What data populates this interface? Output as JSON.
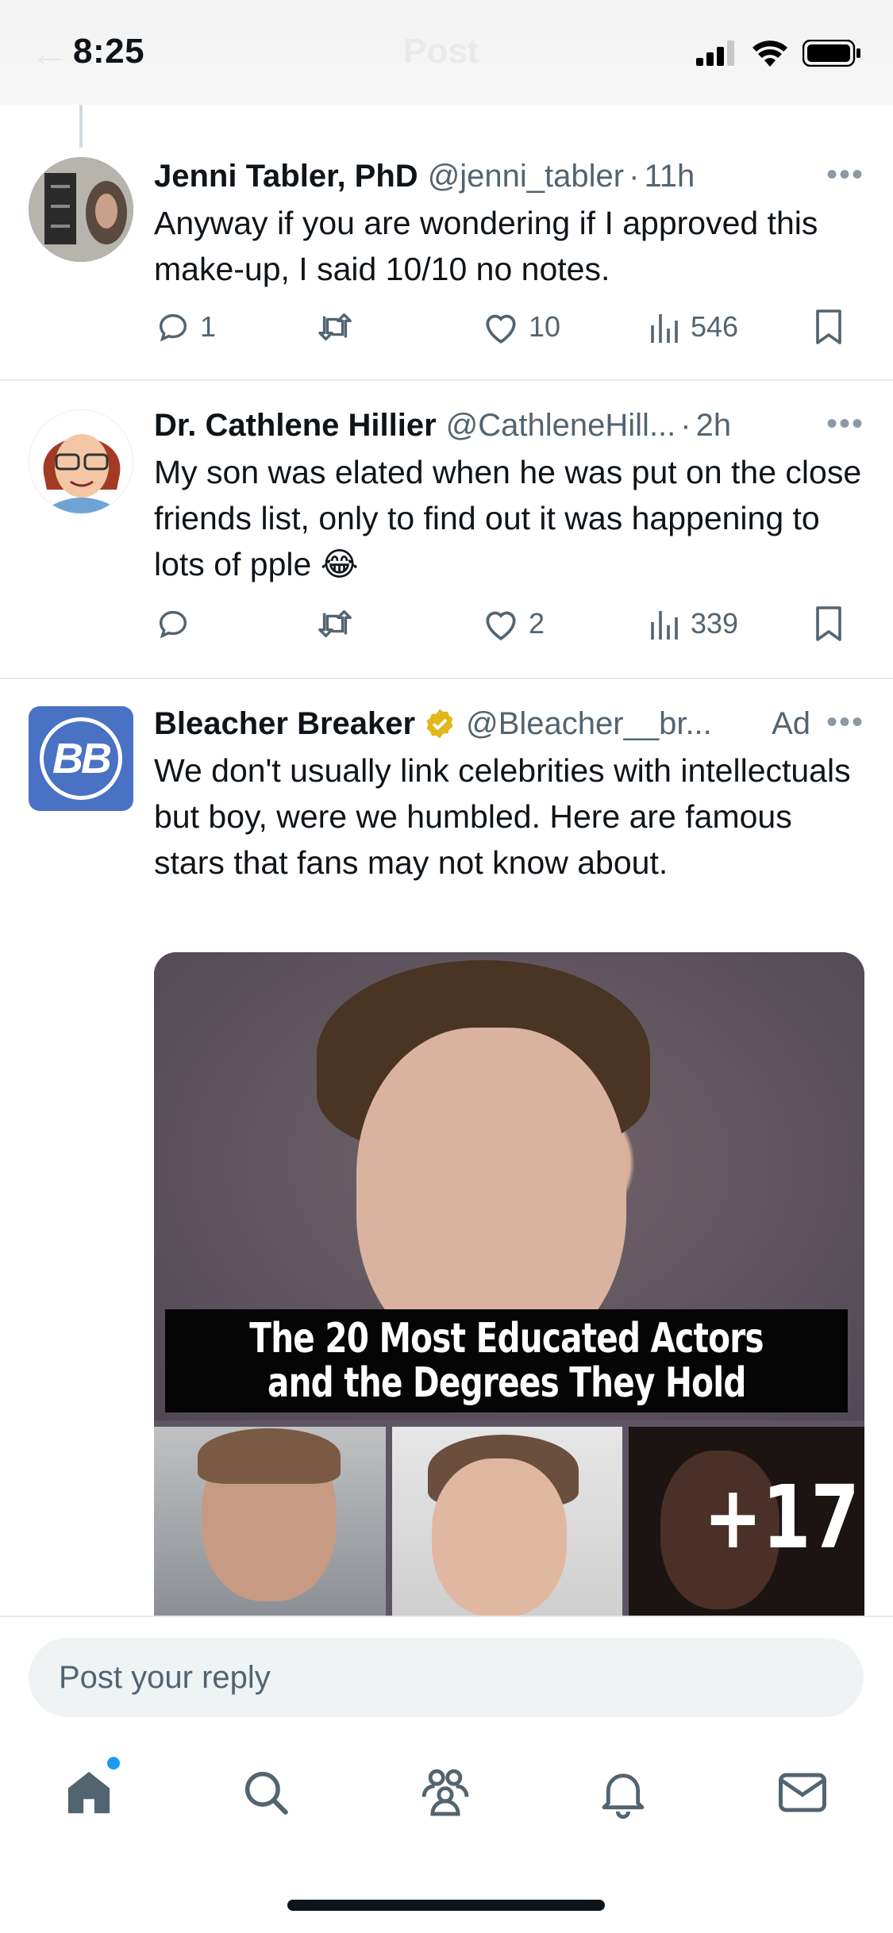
{
  "status_bar": {
    "time": "8:25",
    "title": "Post",
    "icons": [
      "back-arrow-icon",
      "signal-icon",
      "wifi-icon",
      "battery-icon"
    ]
  },
  "tweets": [
    {
      "name": "Jenni Tabler, PhD",
      "handle": "@jenni_tabler",
      "time": "11h",
      "text": "Anyway if you are wondering if I approved this make-up, I said 10/10 no notes.",
      "replies": "1",
      "retweets": "",
      "likes": "10",
      "views": "546"
    },
    {
      "name": "Dr. Cathlene Hillier",
      "handle": "@CathleneHill...",
      "time": "2h",
      "text": "My son was elated when he was put on the close friends list, only to find out it was happening to lots of pple 😂",
      "replies": "",
      "retweets": "",
      "likes": "2",
      "views": "339"
    },
    {
      "name": "Bleacher Breaker",
      "handle": "@Bleacher__br...",
      "ad_label": "Ad",
      "avatar_text": "BB",
      "text": "We don't usually link celebrities with intellectuals but boy, were we humbled. Here are famous stars that fans may not know about.",
      "media": {
        "caption_line1": "The 20 Most Educated Actors",
        "caption_line2": "and the Degrees They Hold",
        "more_count": "+17"
      }
    }
  ],
  "reply": {
    "placeholder": "Post your reply"
  },
  "tabbar": {
    "items": [
      "home-icon",
      "search-icon",
      "communities-icon",
      "notifications-icon",
      "messages-icon"
    ]
  },
  "colors": {
    "accent": "#1d9bf0",
    "secondary_text": "#536471",
    "verified_gold": "#e2b719",
    "ad_avatar": "#4a72c4"
  }
}
